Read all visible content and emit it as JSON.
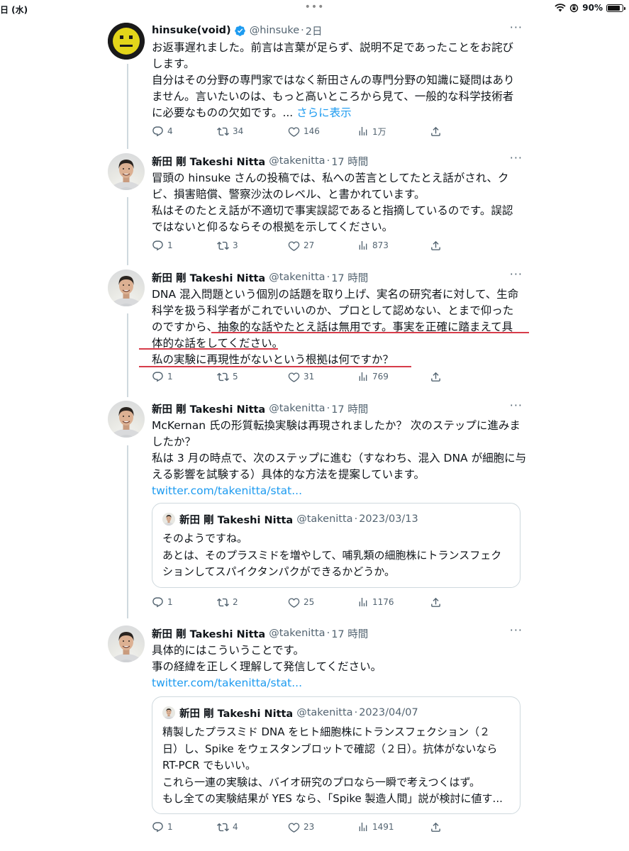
{
  "status_bar": {
    "date": "日 (水)",
    "battery": "90%"
  },
  "tweets": [
    {
      "name": "hinsuke(void)",
      "handle": "@hinsuke",
      "time": "2日",
      "lines": [
        "お返事遅れました。前言は言葉が足らず、説明不足であったことをお詫び",
        "します。",
        "自分はその分野の専門家ではなく新田さんの専門分野の知識に疑問はあり",
        "ません。言いたいのは、もっと高いところから見て、一般的な科学技術者",
        "に必要なものの欠如です。..."
      ],
      "show_more": "さらに表示",
      "replies": "4",
      "retweets": "34",
      "likes": "146",
      "views": "1万"
    },
    {
      "name": "新田 剛 Takeshi Nitta",
      "handle": "@takenitta",
      "time": "17 時間",
      "lines": [
        "冒頭の hinsuke さんの投稿では、私への苦言としてたとえ話がされ、ク",
        "ビ、損害賠償、警察沙汰のレベル、と書かれています。",
        "私はそのたとえ話が不適切で事実誤認であると指摘しているのです。誤認",
        "ではないと仰るならその根拠を示してください。"
      ],
      "replies": "1",
      "retweets": "3",
      "likes": "27",
      "views": "873"
    },
    {
      "name": "新田 剛 Takeshi Nitta",
      "handle": "@takenitta",
      "time": "17 時間",
      "lines": [
        "DNA 混入問題という個別の話題を取り上げ、実名の研究者に対して、生命",
        "科学を扱う科学者がこれでいいのか、プロとして認めない、とまで仰った",
        "のですから、抽象的な話やたとえ話は無用です。事実を正確に踏まえて具",
        "体的な話をしてください。",
        "私の実験に再現性がないという根拠は何ですか？"
      ],
      "replies": "1",
      "retweets": "5",
      "likes": "31",
      "views": "769"
    },
    {
      "name": "新田 剛 Takeshi Nitta",
      "handle": "@takenitta",
      "time": "17 時間",
      "lines": [
        "McKernan 氏の形質転換実験は再現されましたか？ 次のステップに進みま",
        "したか？",
        "私は 3 月の時点で、次のステップに進む（すなわち、混入 DNA が細胞に与",
        "える影響を試験する）具体的な方法を提案しています。"
      ],
      "link": "twitter.com/takenitta/stat...",
      "quote": {
        "name": "新田 剛 Takeshi Nitta",
        "handle": "@takenitta",
        "date": "2023/03/13",
        "lines": [
          "そのようですね。",
          "あとは、そのプラスミドを増やして、哺乳類の細胞株にトランスフェク",
          "ションしてスパイクタンパクができるかどうか。"
        ]
      },
      "replies": "1",
      "retweets": "2",
      "likes": "25",
      "views": "1176"
    },
    {
      "name": "新田 剛 Takeshi Nitta",
      "handle": "@takenitta",
      "time": "17 時間",
      "lines": [
        "具体的にはこういうことです。",
        "事の経緯を正しく理解して発信してください。"
      ],
      "link": "twitter.com/takenitta/stat...",
      "quote": {
        "name": "新田 剛 Takeshi Nitta",
        "handle": "@takenitta",
        "date": "2023/04/07",
        "lines": [
          "精製したプラスミド DNA をヒト細胞株にトランスフェクション（２",
          "日）し、Spike をウェスタンブロットで確認（２日）。抗体がないなら",
          "RT-PCR でもいい。",
          "これら一連の実験は、バイオ研究のプロなら一瞬で考えつくはず。",
          "もし全ての実験結果が YES なら、「Spike 製造人間」説が検討に値す..."
        ]
      },
      "replies": "1",
      "retweets": "4",
      "likes": "23",
      "views": "1491"
    }
  ]
}
